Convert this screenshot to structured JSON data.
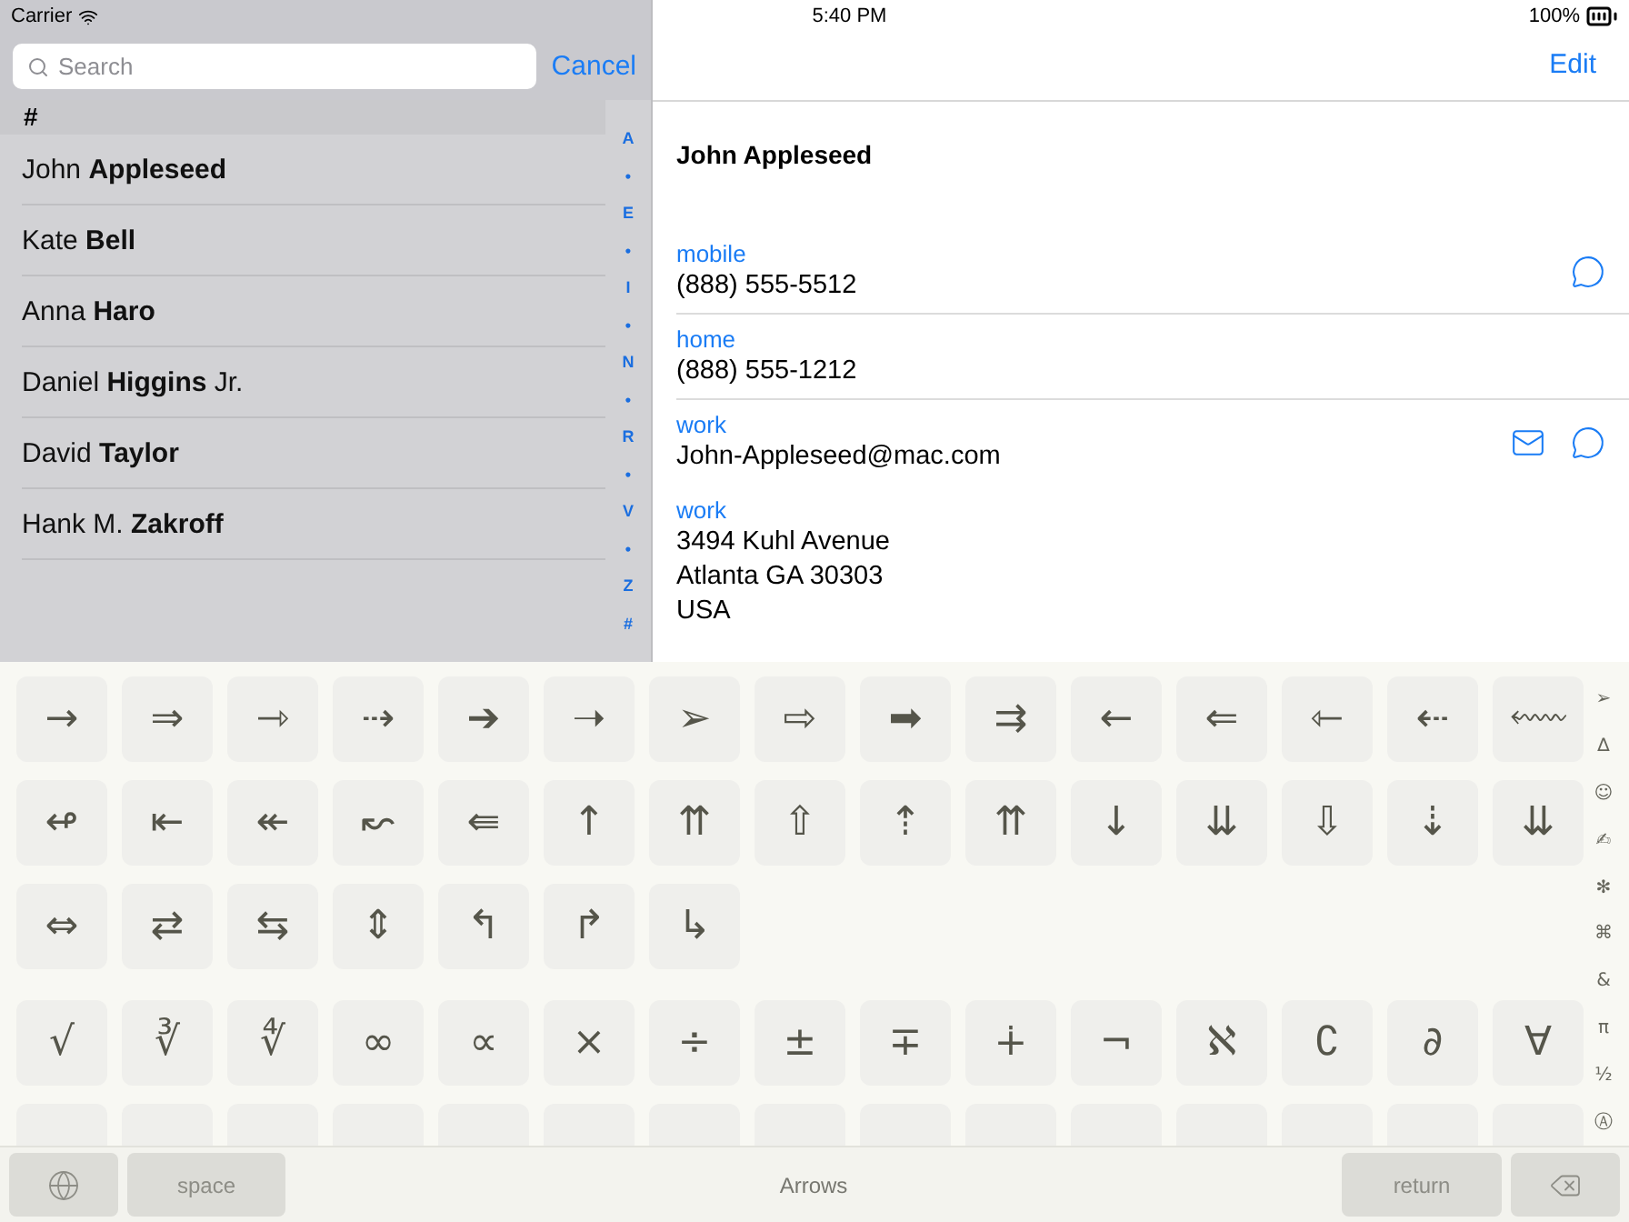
{
  "status_bar": {
    "carrier": "Carrier",
    "time": "5:40 PM",
    "battery": "100%"
  },
  "search": {
    "placeholder": "Search",
    "cancel": "Cancel"
  },
  "contacts": {
    "section": "#",
    "items": [
      {
        "name": "John **Appleseed**",
        "selected": false
      },
      {
        "name": "Kate **Bell**",
        "selected": false
      },
      {
        "name": "Anna **Haro**",
        "selected": false
      },
      {
        "name": "Daniel **Higgins** Jr.",
        "selected": false
      },
      {
        "name": "David **Taylor**",
        "selected": false
      },
      {
        "name": "Hank M. **Zakroff**",
        "selected": false
      }
    ]
  },
  "index": [
    "A",
    "•",
    "E",
    "•",
    "I",
    "•",
    "N",
    "•",
    "R",
    "•",
    "V",
    "•",
    "Z",
    "#"
  ],
  "detail": {
    "edit": "Edit",
    "name": "John Appleseed",
    "fields": [
      {
        "kind": "mobile",
        "label": "mobile",
        "lines": [
          "(888) 555-5512"
        ],
        "divider": false
      },
      {
        "kind": "phone",
        "label": "home",
        "lines": [
          "(888) 555-1212"
        ],
        "divider": true
      },
      {
        "kind": "email",
        "label": "work",
        "lines": [
          "John-Appleseed@mac.com"
        ],
        "divider": true
      },
      {
        "kind": "address",
        "label": "work",
        "lines": [
          "3494 Kuhl Avenue",
          "Atlanta GA 30303",
          "USA"
        ],
        "divider": false
      }
    ]
  },
  "keyboard": {
    "sections": [
      {
        "rows": [
          [
            "→",
            "⇒",
            "⇾",
            "⇢",
            "➔",
            "➝",
            "➢",
            "⇨",
            "➡",
            "⇉",
            "←",
            "⇐",
            "⇽",
            "⇠",
            "⬳"
          ],
          [
            "↫",
            "⇤",
            "↞",
            "↜",
            "⇚",
            "↑",
            "⇈",
            "⇧",
            "⇡",
            "⇈",
            "↓",
            "⇊",
            "⇩",
            "⇣",
            "⇊"
          ],
          [
            "⇔",
            "⇄",
            "⇆",
            "⇕",
            "↰",
            "↱",
            "↳"
          ]
        ]
      },
      {
        "rows": [
          [
            "√",
            "∛",
            "∜",
            "∞",
            "∝",
            "×",
            "÷",
            "±",
            "∓",
            "∔",
            "¬",
            "ℵ",
            "∁",
            "∂",
            "∀"
          ]
        ]
      }
    ],
    "categories": [
      "➢",
      "∆",
      "☺",
      "✍",
      "✻",
      "⌘",
      "&",
      "π",
      "½",
      "Ⓐ"
    ],
    "space": "space",
    "layout_name": "Arrows",
    "return": "return"
  }
}
